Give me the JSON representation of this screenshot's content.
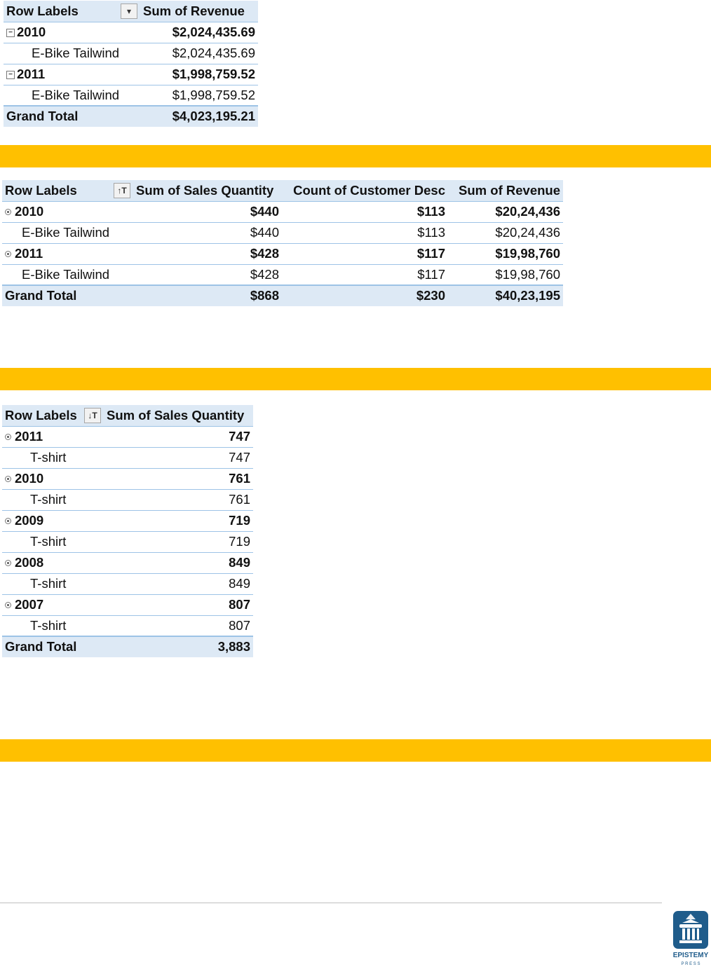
{
  "pivot1": {
    "headers": {
      "row_labels": "Row Labels",
      "revenue": "Sum of Revenue"
    },
    "rows": [
      {
        "label": "2010",
        "revenue": "$2,024,435.69"
      },
      {
        "label": "E-Bike Tailwind",
        "revenue": "$2,024,435.69"
      },
      {
        "label": "2011",
        "revenue": "$1,998,759.52"
      },
      {
        "label": "E-Bike Tailwind",
        "revenue": "$1,998,759.52"
      }
    ],
    "total": {
      "label": "Grand Total",
      "revenue": "$4,023,195.21"
    }
  },
  "pivot2": {
    "headers": {
      "row_labels": "Row Labels",
      "sales_quantity": "Sum of Sales Quantity",
      "customer_count": "Count of Customer Desc",
      "revenue": "Sum of Revenue"
    },
    "rows": [
      {
        "label": "2010",
        "qty": "$440",
        "count": "$113",
        "revenue": "$20,24,436"
      },
      {
        "label": "E-Bike Tailwind",
        "qty": "$440",
        "count": "$113",
        "revenue": "$20,24,436"
      },
      {
        "label": "2011",
        "qty": "$428",
        "count": "$117",
        "revenue": "$19,98,760"
      },
      {
        "label": "E-Bike Tailwind",
        "qty": "$428",
        "count": "$117",
        "revenue": "$19,98,760"
      }
    ],
    "total": {
      "label": "Grand Total",
      "qty": "$868",
      "count": "$230",
      "revenue": "$40,23,195"
    }
  },
  "pivot3": {
    "headers": {
      "row_labels": "Row Labels",
      "sales_quantity": "Sum of Sales Quantity"
    },
    "rows": [
      {
        "label": "2011",
        "qty": "747"
      },
      {
        "label": "T-shirt",
        "qty": "747"
      },
      {
        "label": "2010",
        "qty": "761"
      },
      {
        "label": "T-shirt",
        "qty": "761"
      },
      {
        "label": "2009",
        "qty": "719"
      },
      {
        "label": "T-shirt",
        "qty": "719"
      },
      {
        "label": "2008",
        "qty": "849"
      },
      {
        "label": "T-shirt",
        "qty": "849"
      },
      {
        "label": "2007",
        "qty": "807"
      },
      {
        "label": "T-shirt",
        "qty": "807"
      }
    ],
    "total": {
      "label": "Grand Total",
      "qty": "3,883"
    }
  },
  "icons": {
    "filter_buttons": [
      "filter-dropdown-icon",
      "sort-ascending-filter-icon",
      "sort-descending-filter-icon"
    ],
    "collapse": [
      "collapse-minus-icon",
      "collapse-bullet-icon"
    ]
  },
  "colors": {
    "band": "#ffc000",
    "pivot_header": "#dde9f5",
    "pivot_border": "#9dc3e6",
    "logo_blue": "#1f5c8b"
  },
  "logo": {
    "line1": "EPISTEMY",
    "line2": "P R E S S"
  }
}
